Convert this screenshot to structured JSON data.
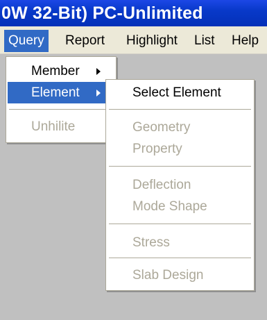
{
  "window": {
    "title": "0W 32-Bit) PC-Unlimited"
  },
  "menubar": {
    "items": [
      {
        "label": "Query"
      },
      {
        "label": "Report"
      },
      {
        "label": "Highlight"
      },
      {
        "label": "List"
      },
      {
        "label": "Help"
      }
    ],
    "active": "Query"
  },
  "query_menu": {
    "items": [
      {
        "label": "Member",
        "has_submenu": true,
        "enabled": true
      },
      {
        "label": "Element",
        "has_submenu": true,
        "enabled": true,
        "highlighted": true
      },
      {
        "label": "Unhilite",
        "has_submenu": false,
        "enabled": false
      }
    ]
  },
  "element_submenu": {
    "items": [
      {
        "label": "Select Element",
        "enabled": true
      },
      {
        "label": "Geometry",
        "enabled": false
      },
      {
        "label": "Property",
        "enabled": false
      },
      {
        "label": "Deflection",
        "enabled": false
      },
      {
        "label": "Mode Shape",
        "enabled": false
      },
      {
        "label": "Stress",
        "enabled": false
      },
      {
        "label": "Slab Design",
        "enabled": false
      }
    ]
  },
  "colors": {
    "title_bar": "#0839c9",
    "highlight": "#316ac5",
    "menu_background": "#ffffff",
    "menubar_background": "#ece9d8",
    "disabled_text": "#aca899",
    "workspace": "#c0c0c0"
  }
}
